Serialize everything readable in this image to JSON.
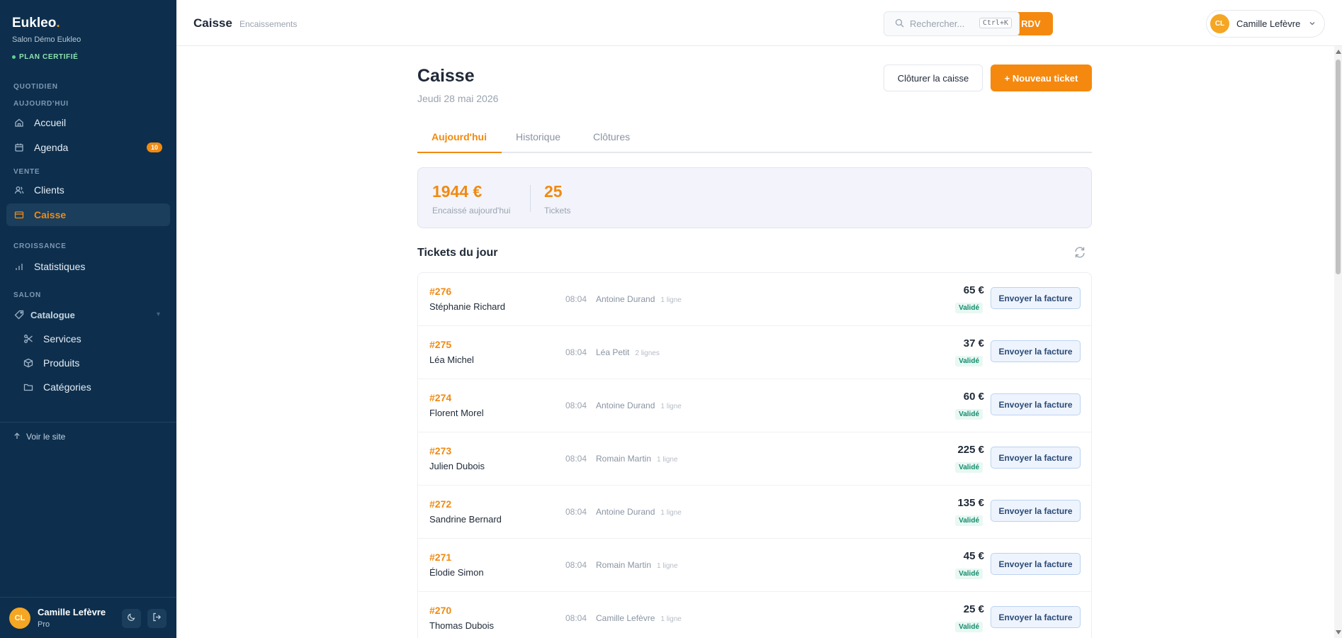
{
  "sidebar": {
    "brand": "Eukleo",
    "brand_dot": ".",
    "salon": "Salon Démo Eukleo",
    "plan": "PLAN CERTIFIÉ",
    "sections": {
      "quotidien": "QUOTIDIEN",
      "aujourdhui": "AUJOURD'HUI",
      "vente": "VENTE",
      "croissance": "CROISSANCE",
      "salon": "SALON"
    },
    "items": {
      "accueil": "Accueil",
      "agenda": "Agenda",
      "agenda_badge": "10",
      "clients": "Clients",
      "caisse": "Caisse",
      "statistiques": "Statistiques",
      "catalogue": "Catalogue",
      "services": "Services",
      "produits": "Produits",
      "categories": "Catégories"
    },
    "site_link": "Voir le site",
    "user": {
      "initials": "CL",
      "name": "Camille Lefèvre",
      "plan": "Pro"
    }
  },
  "topbar": {
    "title": "Caisse",
    "subtitle": "Encaissements",
    "new_rdv": "+ Nouveau RDV",
    "search_placeholder": "Rechercher...",
    "search_shortcut": "Ctrl+K",
    "user_initials": "CL",
    "user_name": "Camille Lefèvre"
  },
  "page": {
    "title": "Caisse",
    "date": "Jeudi 28 mai 2026",
    "close_button": "Clôturer la caisse",
    "new_ticket_button": "+ Nouveau ticket",
    "tabs": [
      "Aujourd'hui",
      "Historique",
      "Clôtures"
    ],
    "stats": {
      "amount": "1944 €",
      "amount_label": "Encaissé aujourd'hui",
      "tickets": "25",
      "tickets_label": "Tickets"
    },
    "section_title": "Tickets du jour"
  },
  "tickets": [
    {
      "num": "#276",
      "client": "Stéphanie Richard",
      "time": "08:04",
      "staff": "Antoine Durand",
      "lines": "1 ligne",
      "amount": "65 €",
      "status": "Validé",
      "action": "Envoyer la facture"
    },
    {
      "num": "#275",
      "client": "Léa Michel",
      "time": "08:04",
      "staff": "Léa Petit",
      "lines": "2 lignes",
      "amount": "37 €",
      "status": "Validé",
      "action": "Envoyer la facture"
    },
    {
      "num": "#274",
      "client": "Florent Morel",
      "time": "08:04",
      "staff": "Antoine Durand",
      "lines": "1 ligne",
      "amount": "60 €",
      "status": "Validé",
      "action": "Envoyer la facture"
    },
    {
      "num": "#273",
      "client": "Julien Dubois",
      "time": "08:04",
      "staff": "Romain Martin",
      "lines": "1 ligne",
      "amount": "225 €",
      "status": "Validé",
      "action": "Envoyer la facture"
    },
    {
      "num": "#272",
      "client": "Sandrine Bernard",
      "time": "08:04",
      "staff": "Antoine Durand",
      "lines": "1 ligne",
      "amount": "135 €",
      "status": "Validé",
      "action": "Envoyer la facture"
    },
    {
      "num": "#271",
      "client": "Élodie Simon",
      "time": "08:04",
      "staff": "Romain Martin",
      "lines": "1 ligne",
      "amount": "45 €",
      "status": "Validé",
      "action": "Envoyer la facture"
    },
    {
      "num": "#270",
      "client": "Thomas Dubois",
      "time": "08:04",
      "staff": "Camille Lefèvre",
      "lines": "1 ligne",
      "amount": "25 €",
      "status": "Validé",
      "action": "Envoyer la facture"
    }
  ],
  "colors": {
    "accent": "#f08a12",
    "sidebar_bg": "#0d2f4d",
    "status_green": "#138a6c"
  }
}
